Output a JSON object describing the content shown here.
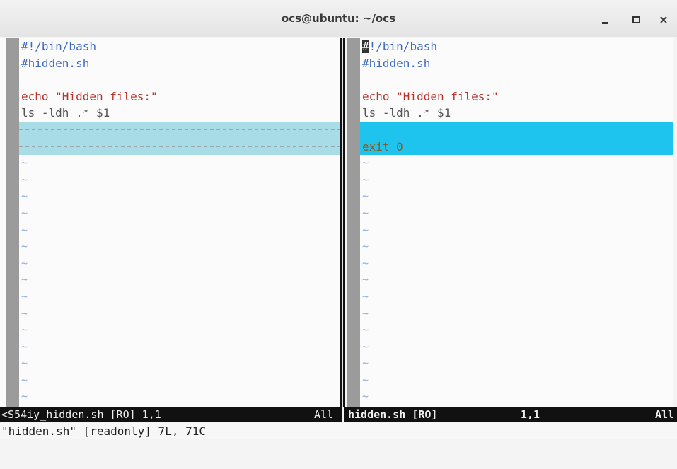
{
  "window": {
    "title": "ocs@ubuntu: ~/ocs",
    "buttons": {
      "minimize": "minimize-icon",
      "maximize": "maximize-icon",
      "close": "close-icon"
    }
  },
  "left_pane": {
    "lines": [
      {
        "type": "comment",
        "text": "#!/bin/bash"
      },
      {
        "type": "comment",
        "text": "#hidden.sh"
      },
      {
        "type": "blank",
        "text": ""
      },
      {
        "type": "echo",
        "keyword": "echo",
        "string": "\"Hidden files:\""
      },
      {
        "type": "plain",
        "text": "ls -ldh .* $1"
      },
      {
        "type": "filler",
        "text": ""
      },
      {
        "type": "filler",
        "text": ""
      }
    ],
    "tilde_count": 15,
    "tilde": "~"
  },
  "right_pane": {
    "lines": [
      {
        "type": "comment-cursor",
        "cursor": "#",
        "text": "!/bin/bash"
      },
      {
        "type": "comment",
        "text": "#hidden.sh"
      },
      {
        "type": "blank",
        "text": ""
      },
      {
        "type": "echo",
        "keyword": "echo",
        "string": "\"Hidden files:\""
      },
      {
        "type": "plain",
        "text": "ls -ldh .* $1"
      },
      {
        "type": "added",
        "text": ""
      },
      {
        "type": "added-exit",
        "text": "exit 0"
      }
    ],
    "tilde_count": 15,
    "tilde": "~"
  },
  "status": {
    "left_file": "<S54iy_hidden.sh [RO] 1,1",
    "left_all": "All",
    "right_file": "hidden.sh [RO]",
    "right_pos": "1,1",
    "right_all": "All"
  },
  "cmdline": "\"hidden.sh\" [readonly] 7L, 71C"
}
